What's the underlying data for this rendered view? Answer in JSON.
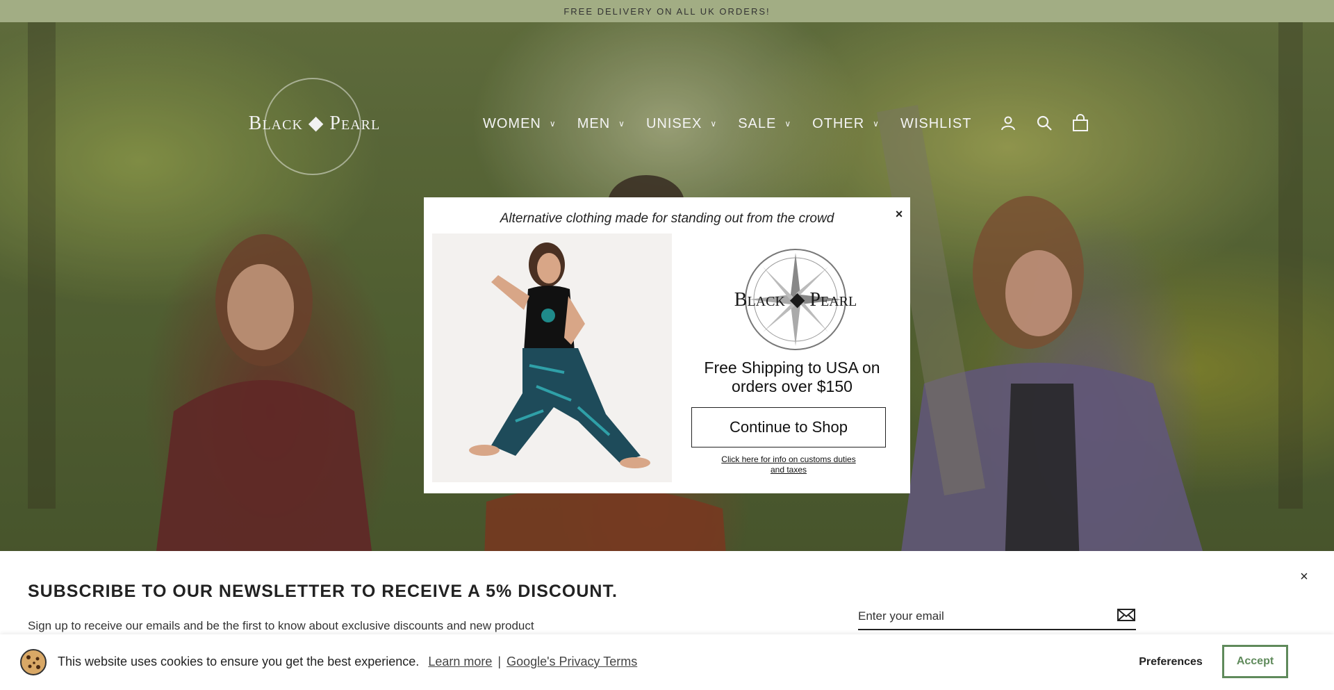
{
  "announcement": {
    "text": "FREE DELIVERY ON ALL UK ORDERS!"
  },
  "header": {
    "logo_text": "Black ◆ Pearl",
    "nav": [
      {
        "label": "WOMEN",
        "has_dropdown": true
      },
      {
        "label": "MEN",
        "has_dropdown": true
      },
      {
        "label": "UNISEX",
        "has_dropdown": true
      },
      {
        "label": "SALE",
        "has_dropdown": true
      },
      {
        "label": "OTHER",
        "has_dropdown": true
      },
      {
        "label": "WISHLIST",
        "has_dropdown": false
      }
    ],
    "icons": [
      "account-icon",
      "search-icon",
      "cart-icon"
    ]
  },
  "modal": {
    "tagline": "Alternative clothing made for standing out from the crowd",
    "close_symbol": "×",
    "logo_text": "Black ◆ Pearl",
    "shipping_text": "Free Shipping to USA on orders over $150",
    "button_label": "Continue to Shop",
    "customs_link": "Click here for info on customs duties and taxes"
  },
  "newsletter": {
    "title": "SUBSCRIBE TO OUR NEWSLETTER TO RECEIVE A 5% DISCOUNT.",
    "text": "Sign up to receive our emails and be the first to know about exclusive discounts and new product",
    "email_placeholder": "Enter your email",
    "close_symbol": "×"
  },
  "cookie": {
    "text": "This website uses cookies to ensure you get the best experience.",
    "learn_more": "Learn more",
    "separator": "|",
    "privacy_link": "Google's Privacy Terms",
    "preferences_label": "Preferences",
    "accept_label": "Accept",
    "accent_color": "#5f8a5b"
  }
}
